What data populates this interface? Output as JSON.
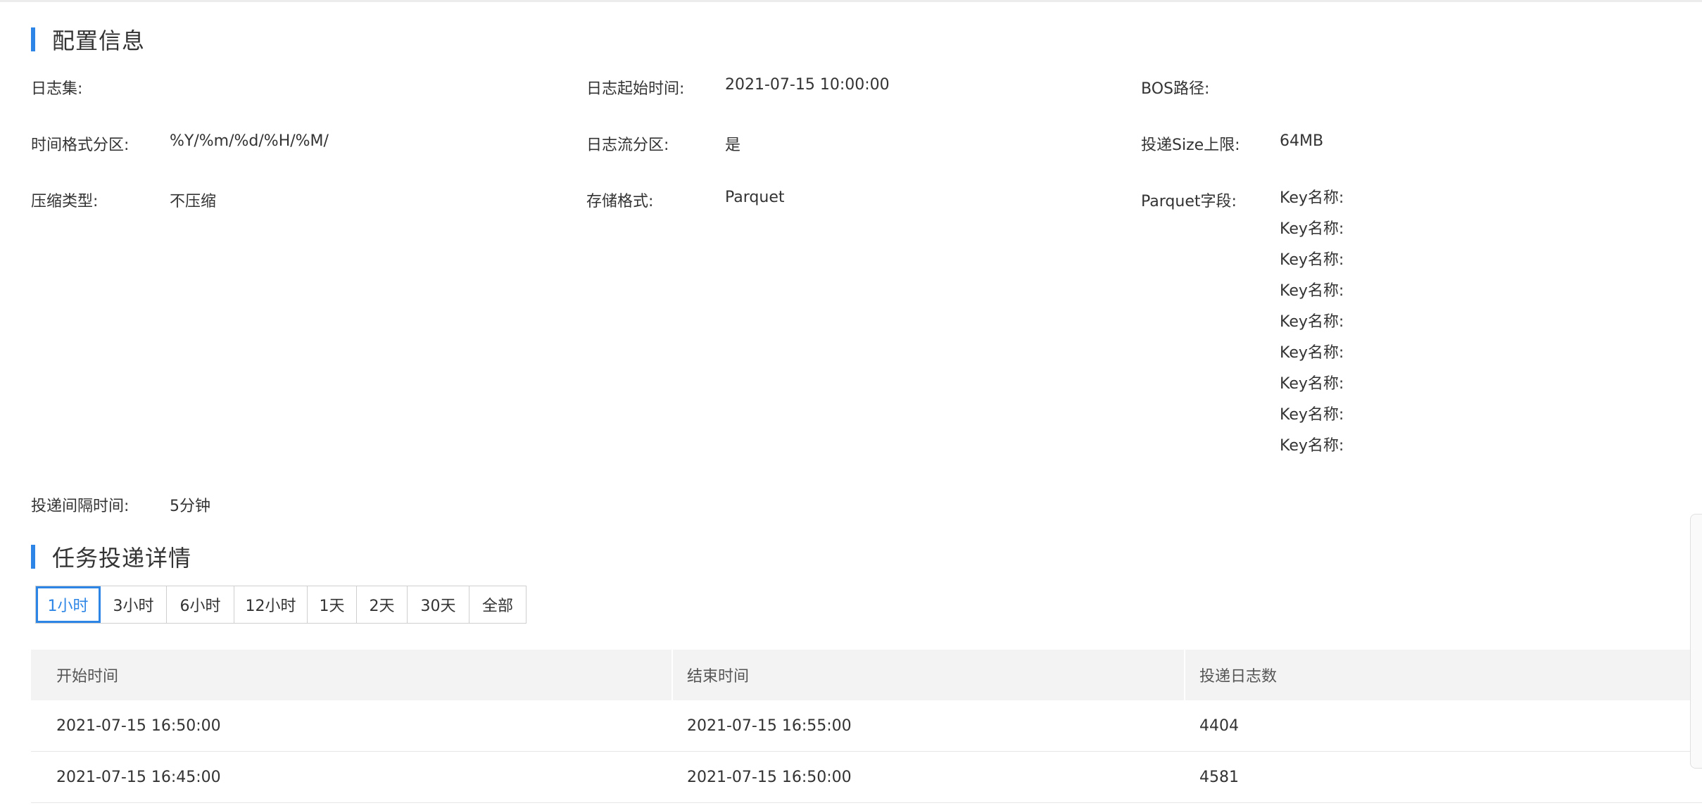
{
  "config": {
    "title": "配置信息",
    "fields": {
      "log_set_label": "日志集:",
      "log_start_time_label": "日志起始时间:",
      "log_start_time_value": "2021-07-15 10:00:00",
      "bos_path_label": "BOS路径:",
      "time_format_label": "时间格式分区:",
      "time_format_value": "%Y/%m/%d/%H/%M/",
      "logstream_partition_label": "日志流分区:",
      "logstream_partition_value": "是",
      "size_limit_label": "投递Size上限:",
      "size_limit_value": "64MB",
      "compression_label": "压缩类型:",
      "compression_value": "不压缩",
      "storage_format_label": "存储格式:",
      "storage_format_value": "Parquet",
      "parquet_fields_label": "Parquet字段:",
      "delivery_interval_label": "投递间隔时间:",
      "delivery_interval_value": "5分钟"
    },
    "parquet_fields": [
      "Key名称:",
      "Key名称:",
      "Key名称:",
      "Key名称:",
      "Key名称:",
      "Key名称:",
      "Key名称:",
      "Key名称:",
      "Key名称:"
    ]
  },
  "delivery": {
    "title": "任务投递详情",
    "tabs": [
      "1小时",
      "3小时",
      "6小时",
      "12小时",
      "1天",
      "2天",
      "30天",
      "全部"
    ],
    "active_tab": "1小时",
    "table": {
      "columns": [
        "开始时间",
        "结束时间",
        "投递日志数"
      ],
      "rows": [
        [
          "2021-07-15 16:50:00",
          "2021-07-15 16:55:00",
          "4404"
        ],
        [
          "2021-07-15 16:45:00",
          "2021-07-15 16:50:00",
          "4581"
        ]
      ]
    }
  },
  "colors": {
    "accent": "#2d86e6",
    "header_bg": "#f3f3f3"
  }
}
